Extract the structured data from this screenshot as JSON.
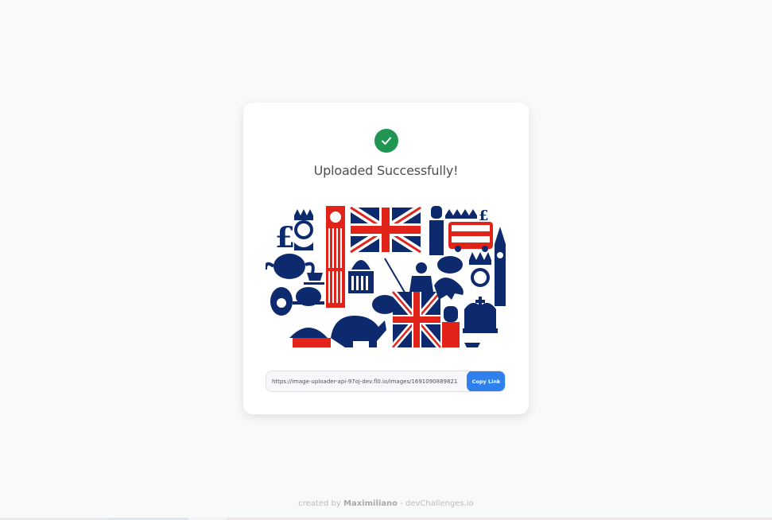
{
  "card": {
    "status_icon": "check-circle-icon",
    "title": "Uploaded Successfully!",
    "image_alt": "United Kingdom icons collage",
    "link": {
      "value": "https://image-uploader-api-97oj-dev.fl0.io/images/1691090889821",
      "button_label": "Copy Link"
    }
  },
  "footer": {
    "prefix": "created by",
    "author": "Maximiliano",
    "separator": " - ",
    "site": "devChallenges.io"
  },
  "colors": {
    "accent": "#2F80ED",
    "success": "#219653",
    "navy": "#0d2a6e",
    "red": "#e2231a"
  }
}
